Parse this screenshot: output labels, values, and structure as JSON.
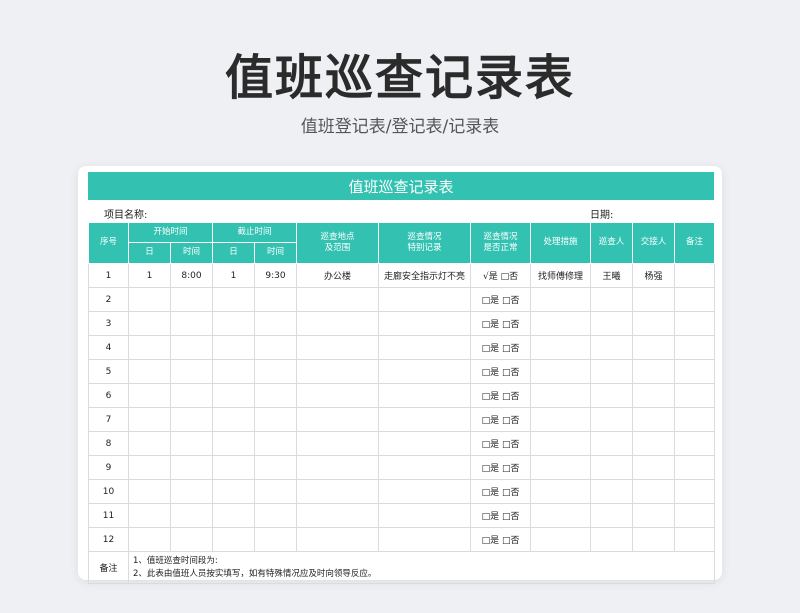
{
  "page": {
    "title": "值班巡查记录表",
    "subtitle": "值班登记表/登记表/记录表"
  },
  "sheet": {
    "title": "值班巡查记录表",
    "project_label": "项目名称:",
    "date_label": "日期:",
    "headers": {
      "seq": "序号",
      "start_time": "开始时间",
      "end_time": "截止时间",
      "day": "日",
      "time": "时间",
      "location_l1": "巡查地点",
      "location_l2": "及范围",
      "situation_l1": "巡查情况",
      "situation_l2": "特别记录",
      "normal_l1": "巡查情况",
      "normal_l2": "是否正常",
      "measures": "处理措施",
      "inspector": "巡查人",
      "handover": "交接人",
      "remarks": "备注"
    },
    "rows": [
      {
        "seq": "1",
        "start_day": "1",
        "start_time": "8:00",
        "end_day": "1",
        "end_time": "9:30",
        "location": "办公楼",
        "record": "走廊安全指示灯不亮",
        "normal": "√是 □否",
        "measures": "找师傅修理",
        "inspector": "王曦",
        "handover": "杨强",
        "remark": ""
      },
      {
        "seq": "2",
        "start_day": "",
        "start_time": "",
        "end_day": "",
        "end_time": "",
        "location": "",
        "record": "",
        "normal": "□是 □否",
        "measures": "",
        "inspector": "",
        "handover": "",
        "remark": ""
      },
      {
        "seq": "3",
        "start_day": "",
        "start_time": "",
        "end_day": "",
        "end_time": "",
        "location": "",
        "record": "",
        "normal": "□是 □否",
        "measures": "",
        "inspector": "",
        "handover": "",
        "remark": ""
      },
      {
        "seq": "4",
        "start_day": "",
        "start_time": "",
        "end_day": "",
        "end_time": "",
        "location": "",
        "record": "",
        "normal": "□是 □否",
        "measures": "",
        "inspector": "",
        "handover": "",
        "remark": ""
      },
      {
        "seq": "5",
        "start_day": "",
        "start_time": "",
        "end_day": "",
        "end_time": "",
        "location": "",
        "record": "",
        "normal": "□是 □否",
        "measures": "",
        "inspector": "",
        "handover": "",
        "remark": ""
      },
      {
        "seq": "6",
        "start_day": "",
        "start_time": "",
        "end_day": "",
        "end_time": "",
        "location": "",
        "record": "",
        "normal": "□是 □否",
        "measures": "",
        "inspector": "",
        "handover": "",
        "remark": ""
      },
      {
        "seq": "7",
        "start_day": "",
        "start_time": "",
        "end_day": "",
        "end_time": "",
        "location": "",
        "record": "",
        "normal": "□是 □否",
        "measures": "",
        "inspector": "",
        "handover": "",
        "remark": ""
      },
      {
        "seq": "8",
        "start_day": "",
        "start_time": "",
        "end_day": "",
        "end_time": "",
        "location": "",
        "record": "",
        "normal": "□是 □否",
        "measures": "",
        "inspector": "",
        "handover": "",
        "remark": ""
      },
      {
        "seq": "9",
        "start_day": "",
        "start_time": "",
        "end_day": "",
        "end_time": "",
        "location": "",
        "record": "",
        "normal": "□是 □否",
        "measures": "",
        "inspector": "",
        "handover": "",
        "remark": ""
      },
      {
        "seq": "10",
        "start_day": "",
        "start_time": "",
        "end_day": "",
        "end_time": "",
        "location": "",
        "record": "",
        "normal": "□是 □否",
        "measures": "",
        "inspector": "",
        "handover": "",
        "remark": ""
      },
      {
        "seq": "11",
        "start_day": "",
        "start_time": "",
        "end_day": "",
        "end_time": "",
        "location": "",
        "record": "",
        "normal": "□是 □否",
        "measures": "",
        "inspector": "",
        "handover": "",
        "remark": ""
      },
      {
        "seq": "12",
        "start_day": "",
        "start_time": "",
        "end_day": "",
        "end_time": "",
        "location": "",
        "record": "",
        "normal": "□是 □否",
        "measures": "",
        "inspector": "",
        "handover": "",
        "remark": ""
      }
    ],
    "notes": {
      "label": "备注",
      "line1": "1、值班巡查时间段为:",
      "line2": "2、此表由值班人员按实填写，如有特殊情况应及时向领导反应。"
    }
  }
}
